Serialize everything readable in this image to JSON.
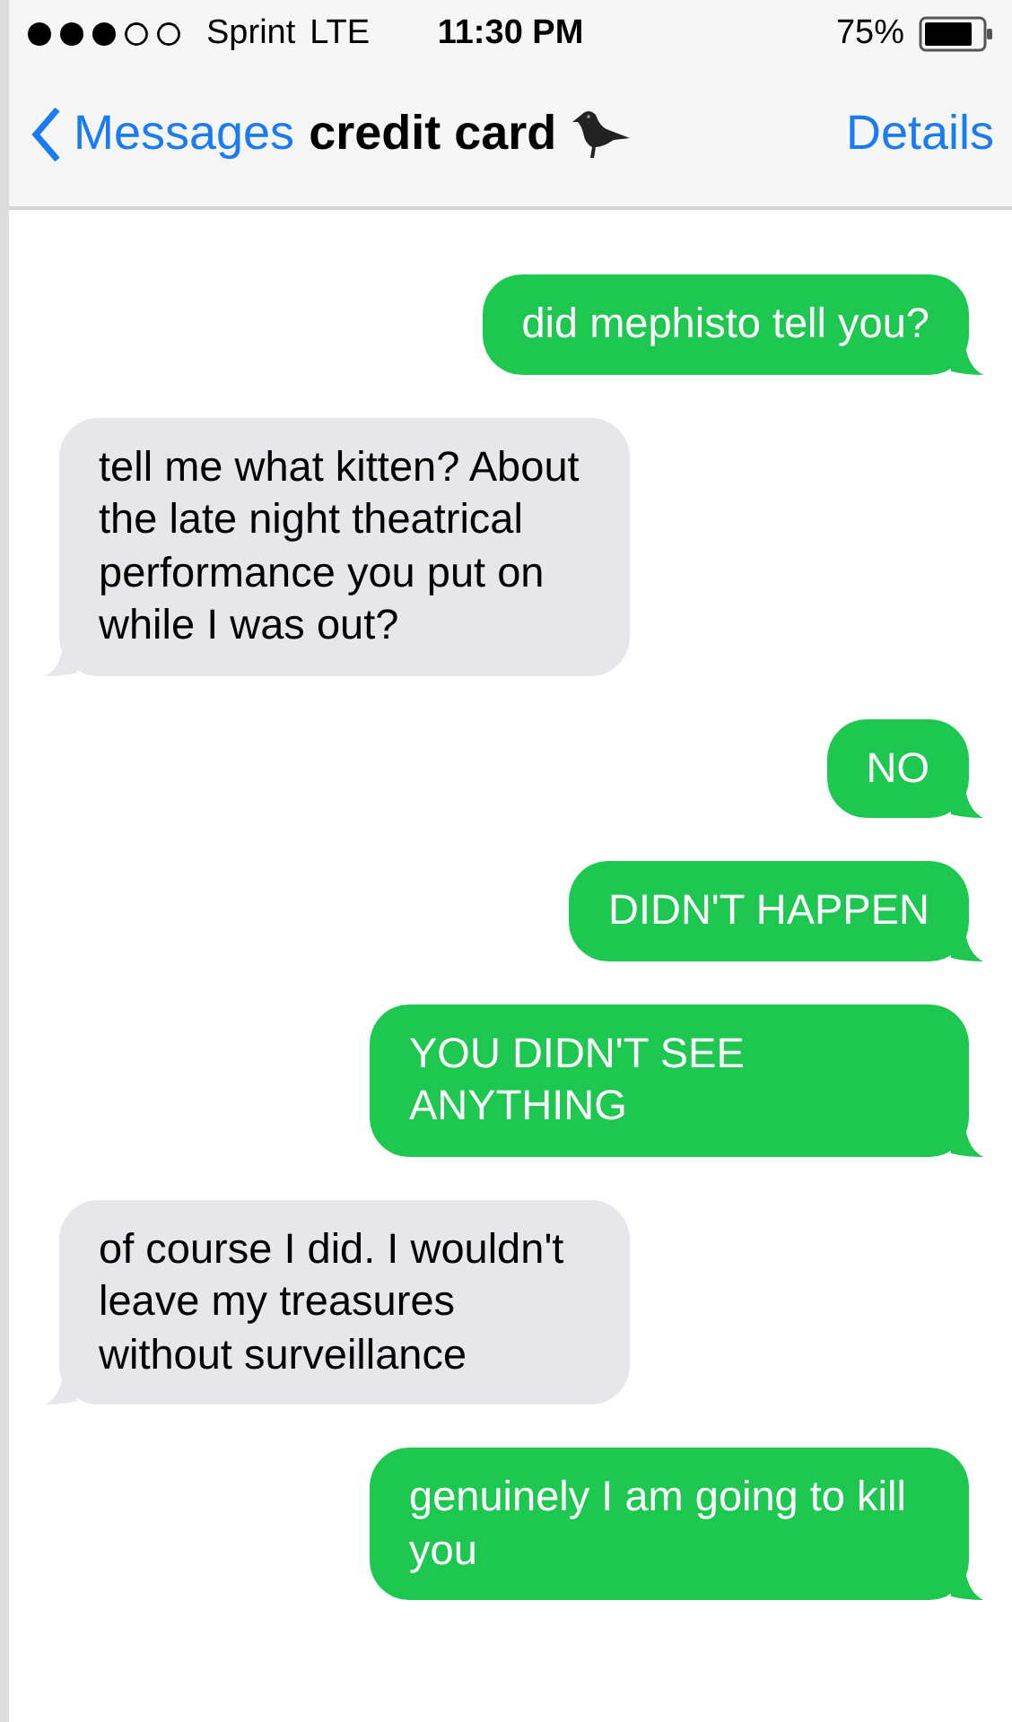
{
  "status_bar": {
    "carrier": "Sprint",
    "network": "LTE",
    "time": "11:30 PM",
    "battery_percent": "75%"
  },
  "nav_bar": {
    "back_label": "Messages",
    "title": "credit card",
    "action": "Details"
  },
  "messages": [
    {
      "kind": "sent",
      "text": "did mephisto tell you?"
    },
    {
      "kind": "received",
      "text": "tell me what kitten? About the late night theatrical performance you put on while I was out?"
    },
    {
      "kind": "sent",
      "text": "NO"
    },
    {
      "kind": "sent",
      "text": "DIDN'T HAPPEN"
    },
    {
      "kind": "sent",
      "text": "YOU DIDN'T SEE ANYTHING"
    },
    {
      "kind": "received",
      "text": "of course I did. I wouldn't leave my treasures without surveillance"
    },
    {
      "kind": "sent",
      "text": "genuinely I am going to kill you"
    }
  ]
}
